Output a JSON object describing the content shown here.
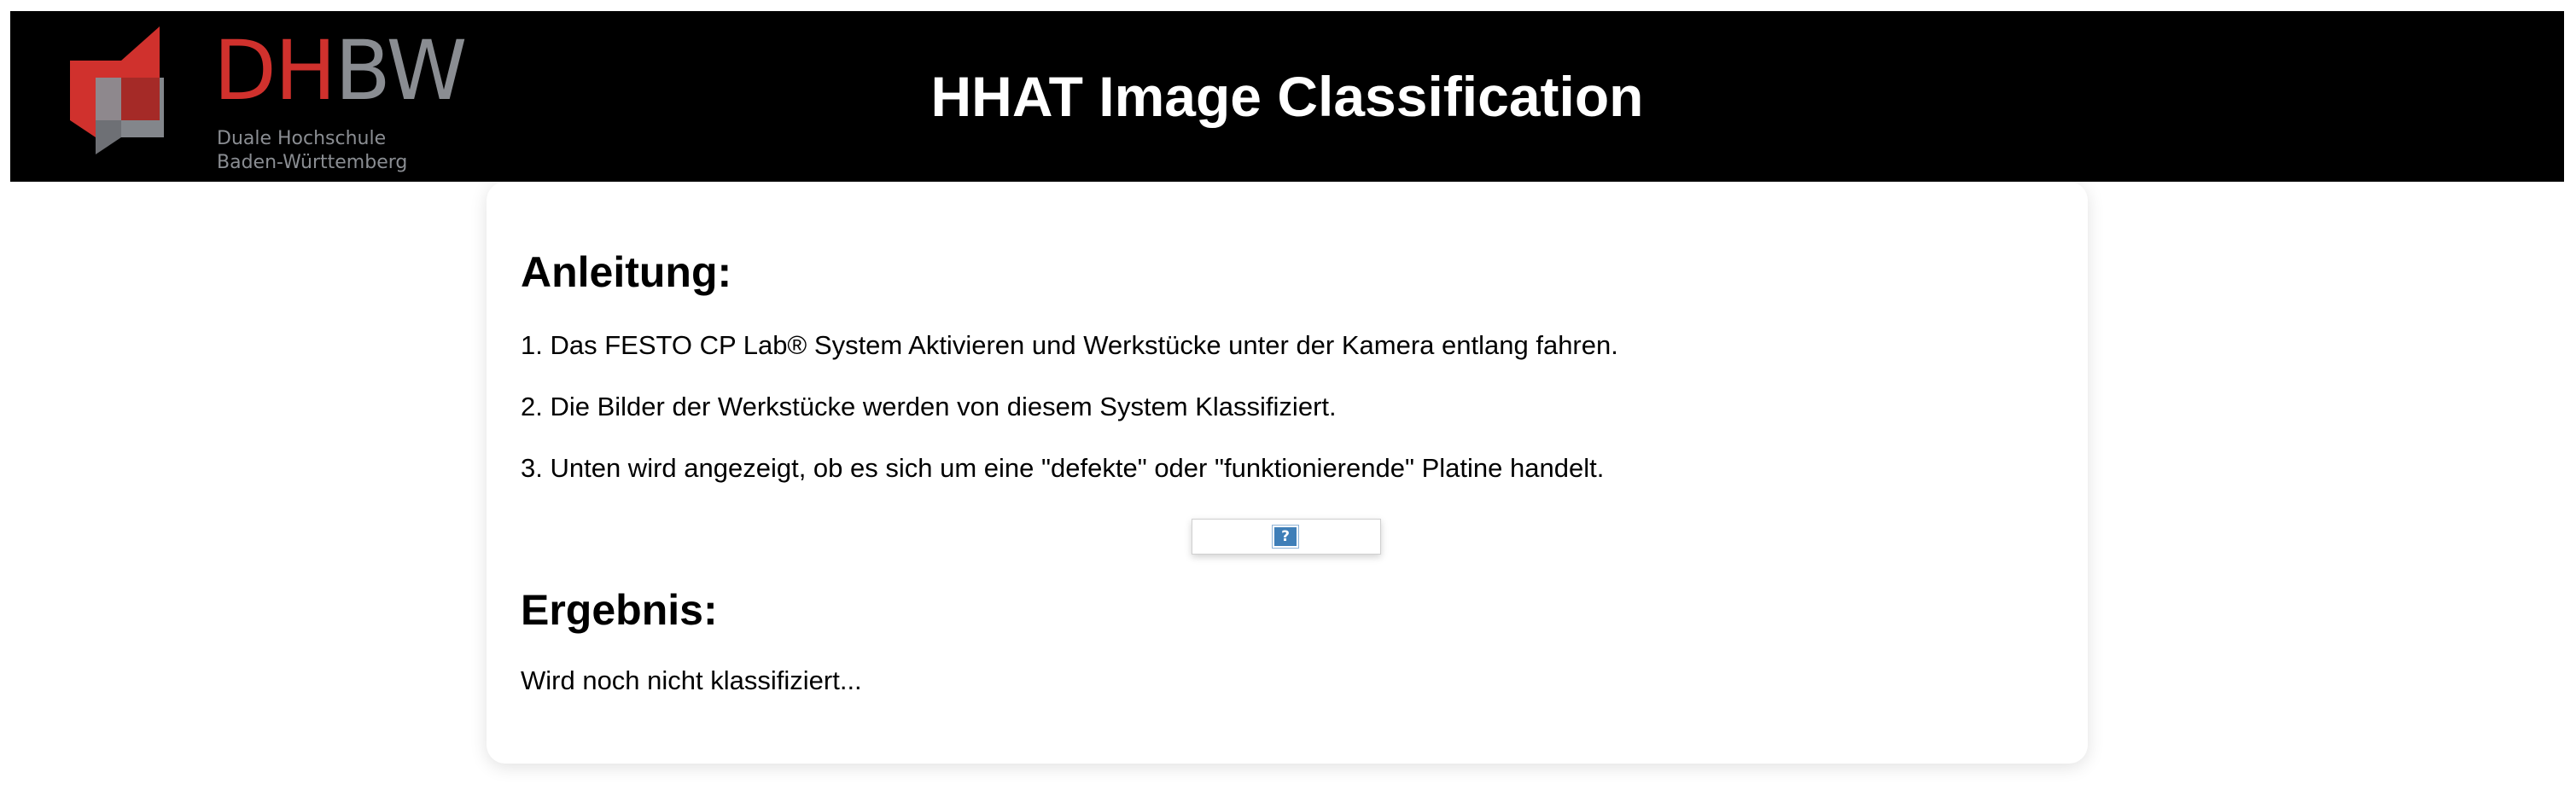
{
  "header": {
    "logo": {
      "wordmark_red": "DH",
      "wordmark_gray": "BW",
      "subtitle_line1": "Duale Hochschule",
      "subtitle_line2": "Baden-Württemberg",
      "colors": {
        "red": "#d0312d",
        "gray": "#8a8d92"
      }
    },
    "title": "HHAT Image Classification",
    "background": "#000000"
  },
  "instructions": {
    "heading": "Anleitung:",
    "steps": [
      "1. Das FESTO CP Lab® System Aktivieren und Werkstücke unter der Kamera entlang fahren.",
      "2. Die Bilder der Werkstücke werden von diesem System Klassifiziert.",
      "3. Unten wird angezeigt, ob es sich um eine \"defekte\" oder \"funktionierende\" Platine handelt."
    ]
  },
  "image": {
    "icon": "broken-image-icon",
    "glyph": "?"
  },
  "result": {
    "heading": "Ergebnis:",
    "text": "Wird noch nicht klassifiziert..."
  }
}
